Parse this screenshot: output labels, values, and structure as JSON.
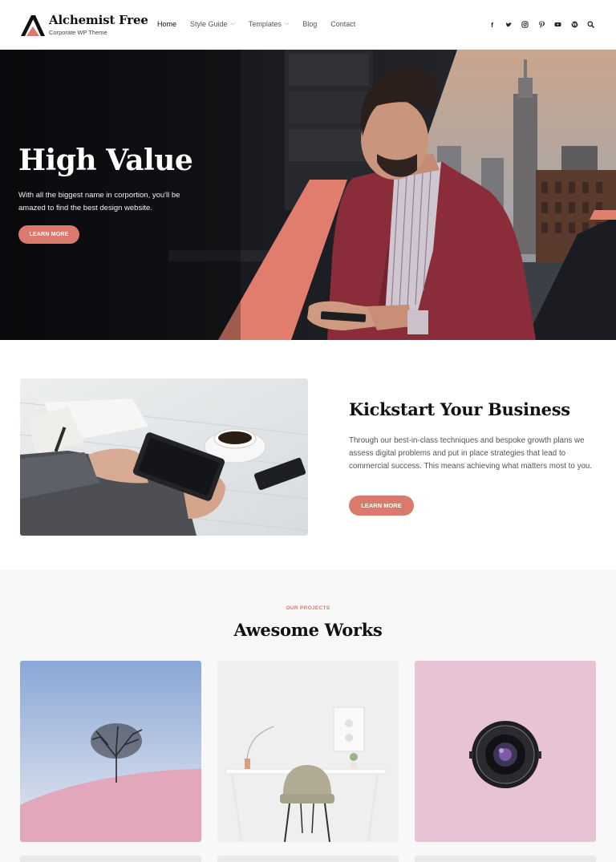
{
  "header": {
    "site_title": "Alchemist Free",
    "tagline": "Corporate WP Theme",
    "nav": [
      {
        "label": "Home",
        "active": true,
        "has_dropdown": false
      },
      {
        "label": "Style Guide",
        "active": false,
        "has_dropdown": true
      },
      {
        "label": "Templates",
        "active": false,
        "has_dropdown": true
      },
      {
        "label": "Blog",
        "active": false,
        "has_dropdown": false
      },
      {
        "label": "Contact",
        "active": false,
        "has_dropdown": false
      }
    ],
    "social_icons": [
      "facebook-icon",
      "twitter-icon",
      "instagram-icon",
      "pinterest-icon",
      "youtube-icon",
      "wordpress-icon",
      "search-icon"
    ]
  },
  "hero": {
    "title": "High Value",
    "text": "With all the biggest name in corportion, you'll be amazed to find the best design website.",
    "button": "LEARN MORE"
  },
  "feature": {
    "title": "Kickstart Your Business",
    "text": "Through our best-in-class techniques and bespoke growth plans we assess digital problems and put in place strategies that lead to commercial success. This means achieving what matters most to you.",
    "button": "LEARN MORE"
  },
  "projects": {
    "eyebrow": "OUR PROJECTS",
    "title": "Awesome Works"
  },
  "colors": {
    "accent": "#d97a6c",
    "heading": "#111111",
    "body_text": "#555555",
    "section_bg": "#f8f8f8"
  }
}
